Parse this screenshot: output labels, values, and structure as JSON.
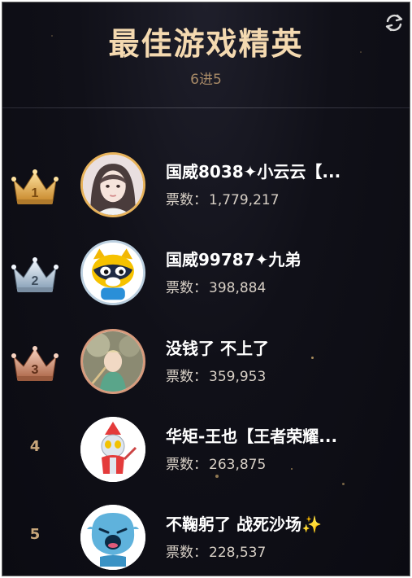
{
  "header": {
    "title": "最佳游戏精英",
    "subtitle": "6进5",
    "refresh_icon": "refresh-icon"
  },
  "votes_label": "票数：",
  "rankings": [
    {
      "rank": "1",
      "name": "国威8038✦小云云【...",
      "votes": "1,779,217",
      "badge": "gold-crown-icon",
      "color": "#e7b25a"
    },
    {
      "rank": "2",
      "name": "国威99787✦九弟",
      "votes": "398,884",
      "badge": "silver-crown-icon",
      "color": "#bcd0e0"
    },
    {
      "rank": "3",
      "name": "没钱了 不上了",
      "votes": "359,953",
      "badge": "bronze-crown-icon",
      "color": "#d79a7c"
    },
    {
      "rank": "4",
      "name": "华矩-王也【王者荣耀...",
      "votes": "263,875"
    },
    {
      "rank": "5",
      "name": "不鞠躬了 战死沙场✨",
      "votes": "228,537"
    }
  ]
}
